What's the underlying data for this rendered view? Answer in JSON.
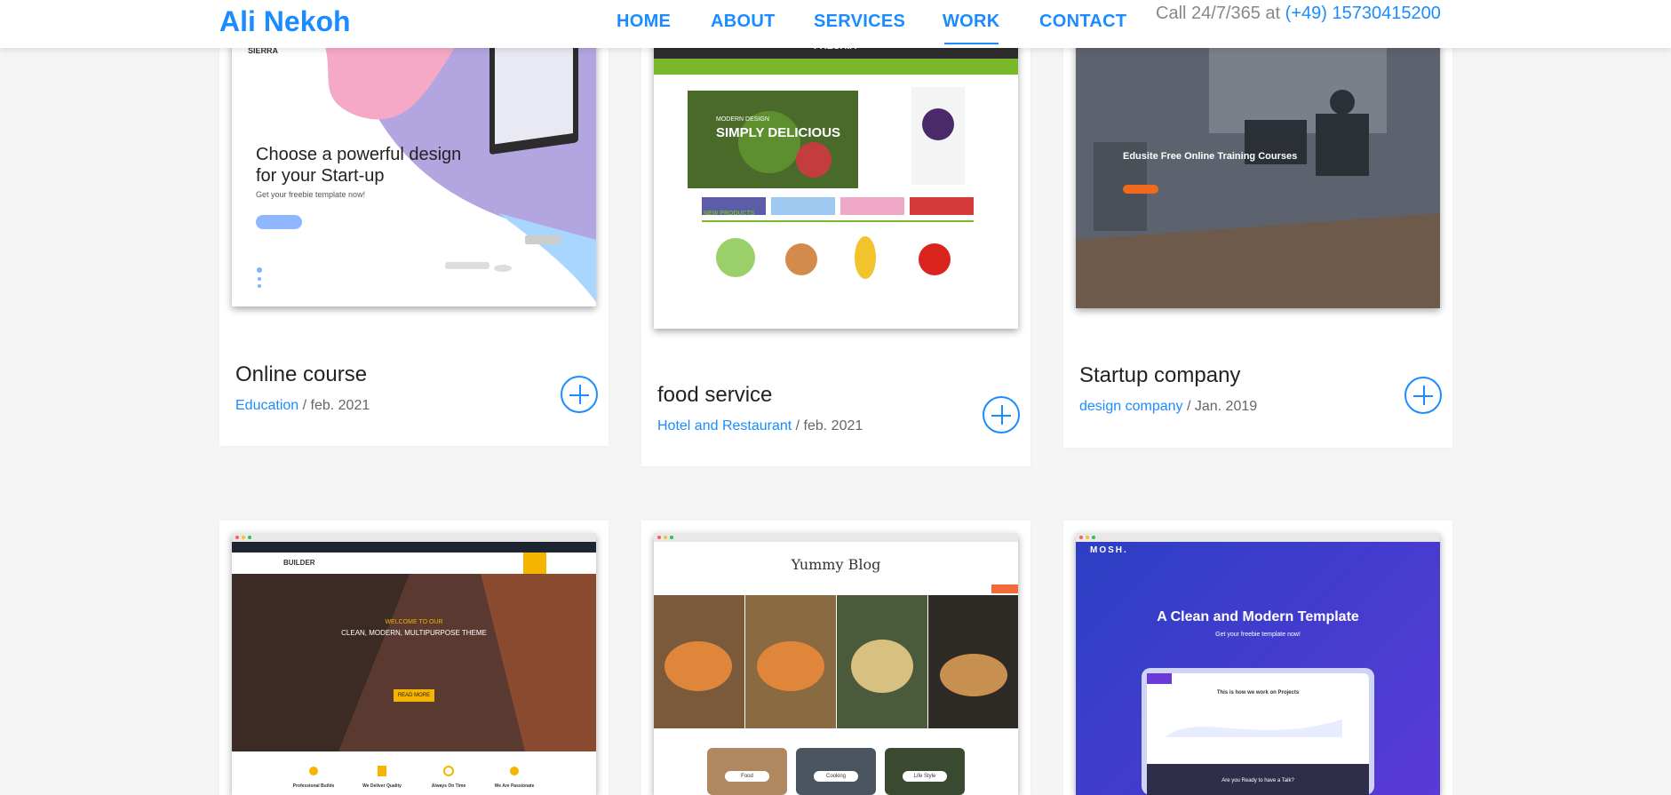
{
  "header": {
    "brand": "Ali Nekoh",
    "nav": [
      {
        "label": "HOME",
        "active": false
      },
      {
        "label": "ABOUT",
        "active": false
      },
      {
        "label": "SERVICES",
        "active": false
      },
      {
        "label": "WORK",
        "active": true
      },
      {
        "label": "CONTACT",
        "active": false
      }
    ],
    "call_prefix": "Call 24/7/365 at",
    "phone": "(+49) 15730415200"
  },
  "projects": [
    {
      "title": "Online course",
      "category": "Education",
      "date": "feb. 2021",
      "thumb": {
        "logo": "SIERRA",
        "headline": "Choose a powerful design for your Start-up",
        "sub": "Get your freebie template now!"
      }
    },
    {
      "title": "food service",
      "category": "Hotel and Restaurant",
      "date": "feb. 2021",
      "thumb": {
        "logo": "FRESHIA",
        "hero_small": "MODERN DESIGN",
        "hero": "SIMPLY DELICIOUS",
        "section": "NEW PRODUCTS"
      }
    },
    {
      "title": "Startup company",
      "category": "design company",
      "date": "Jan. 2019",
      "thumb": {
        "headline": "Edusite Free Online Training Courses"
      }
    },
    {
      "thumb": {
        "logo": "BUILDER",
        "small": "WELCOME TO OUR",
        "headline": "CLEAN, MODERN, MULTIPURPOSE THEME",
        "button": "READ MORE",
        "features": [
          "Professional Builds",
          "We Deliver Quality",
          "Always On Time",
          "We Are Passionate"
        ]
      }
    },
    {
      "thumb": {
        "logo": "Yummy Blog",
        "tags": [
          "Food",
          "Cooking",
          "Life Style"
        ]
      }
    },
    {
      "thumb": {
        "logo": "MOSH.",
        "headline": "A Clean and Modern Template",
        "sub": "Get your freebie template now!",
        "inner_title": "This is how we work on Projects",
        "inner_cta": "Are you Ready to have a Talk?"
      }
    }
  ],
  "colors": {
    "accent": "#1a8cff",
    "background": "#f5f5f5"
  },
  "icons": {
    "plus": "circled-plus-icon"
  }
}
